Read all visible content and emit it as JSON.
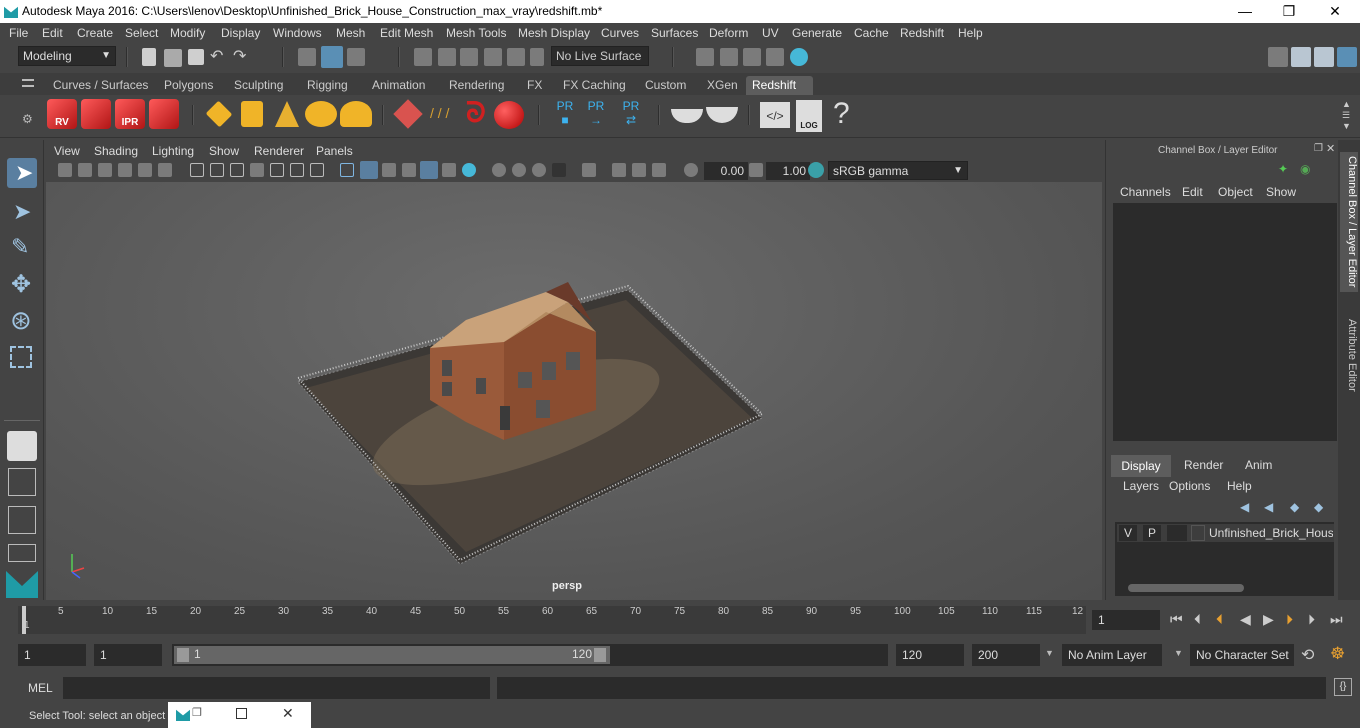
{
  "window": {
    "title": "Autodesk Maya 2016: C:\\Users\\lenov\\Desktop\\Unfinished_Brick_House_Construction_max_vray\\redshift.mb*",
    "minimize": "—",
    "maximize": "❐",
    "close": "✕"
  },
  "menubar": [
    "File",
    "Edit",
    "Create",
    "Select",
    "Modify",
    "Display",
    "Windows",
    "Mesh",
    "Edit Mesh",
    "Mesh Tools",
    "Mesh Display",
    "Curves",
    "Surfaces",
    "Deform",
    "UV",
    "Generate",
    "Cache",
    "Redshift",
    "Help"
  ],
  "statusline": {
    "mode": "Modeling",
    "live_surface": "No Live Surface"
  },
  "shelf_tabs": [
    "Curves / Surfaces",
    "Polygons",
    "Sculpting",
    "Rigging",
    "Animation",
    "Rendering",
    "FX",
    "FX Caching",
    "Custom",
    "XGen",
    "Redshift"
  ],
  "shelf_selected": "Redshift",
  "shelf_icons": {
    "rv": "RV",
    "ipr": "IPR",
    "pr": "PR",
    "log": "LOG",
    "help": "?"
  },
  "viewport": {
    "menu": [
      "View",
      "Shading",
      "Lighting",
      "Show",
      "Renderer",
      "Panels"
    ],
    "exposure": "0.00",
    "gamma": "1.00",
    "color_space": "sRGB gamma",
    "camera_label": "persp"
  },
  "channel_box": {
    "title": "Channel Box / Layer Editor",
    "menu": [
      "Channels",
      "Edit",
      "Object",
      "Show"
    ]
  },
  "layer_editor": {
    "tabs": [
      "Display",
      "Render",
      "Anim"
    ],
    "menu": [
      "Layers",
      "Options",
      "Help"
    ],
    "layer": {
      "v": "V",
      "p": "P",
      "name": "Unfinished_Brick_House"
    }
  },
  "side_tabs": [
    "Channel Box / Layer Editor",
    "Attribute Editor"
  ],
  "timeline": {
    "ticks": [
      "1",
      "5",
      "10",
      "15",
      "20",
      "25",
      "30",
      "35",
      "40",
      "45",
      "50",
      "55",
      "60",
      "65",
      "70",
      "75",
      "80",
      "85",
      "90",
      "95",
      "100",
      "105",
      "110",
      "115",
      "12"
    ],
    "current_frame": "1"
  },
  "range": {
    "start": "1",
    "current": "1",
    "slider_start": "1",
    "slider_end": "120",
    "end": "120",
    "anim_end": "200",
    "anim_layer": "No Anim Layer",
    "character_set": "No Character Set"
  },
  "mel": {
    "label": "MEL"
  },
  "help_line": "Select Tool: select an object"
}
